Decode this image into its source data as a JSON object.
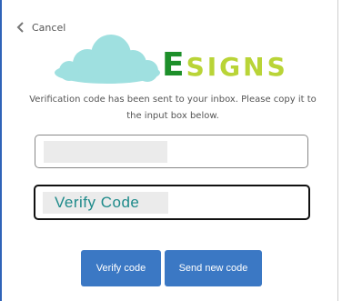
{
  "nav": {
    "cancel_label": "Cancel"
  },
  "logo": {
    "initial": "E",
    "rest": "SIGNS",
    "colors": {
      "cloud": "#9fe0e0",
      "initial": "#1d8f2a",
      "rest": "#b9d437"
    }
  },
  "message": "Verification code has been sent to your inbox. Please copy it to the input box below.",
  "form": {
    "code_value": "Verify Code"
  },
  "buttons": {
    "verify_label": "Verify code",
    "send_new_label": "Send new code"
  },
  "colors": {
    "accent": "#3b78c4",
    "code_text": "#1e8a8a"
  }
}
